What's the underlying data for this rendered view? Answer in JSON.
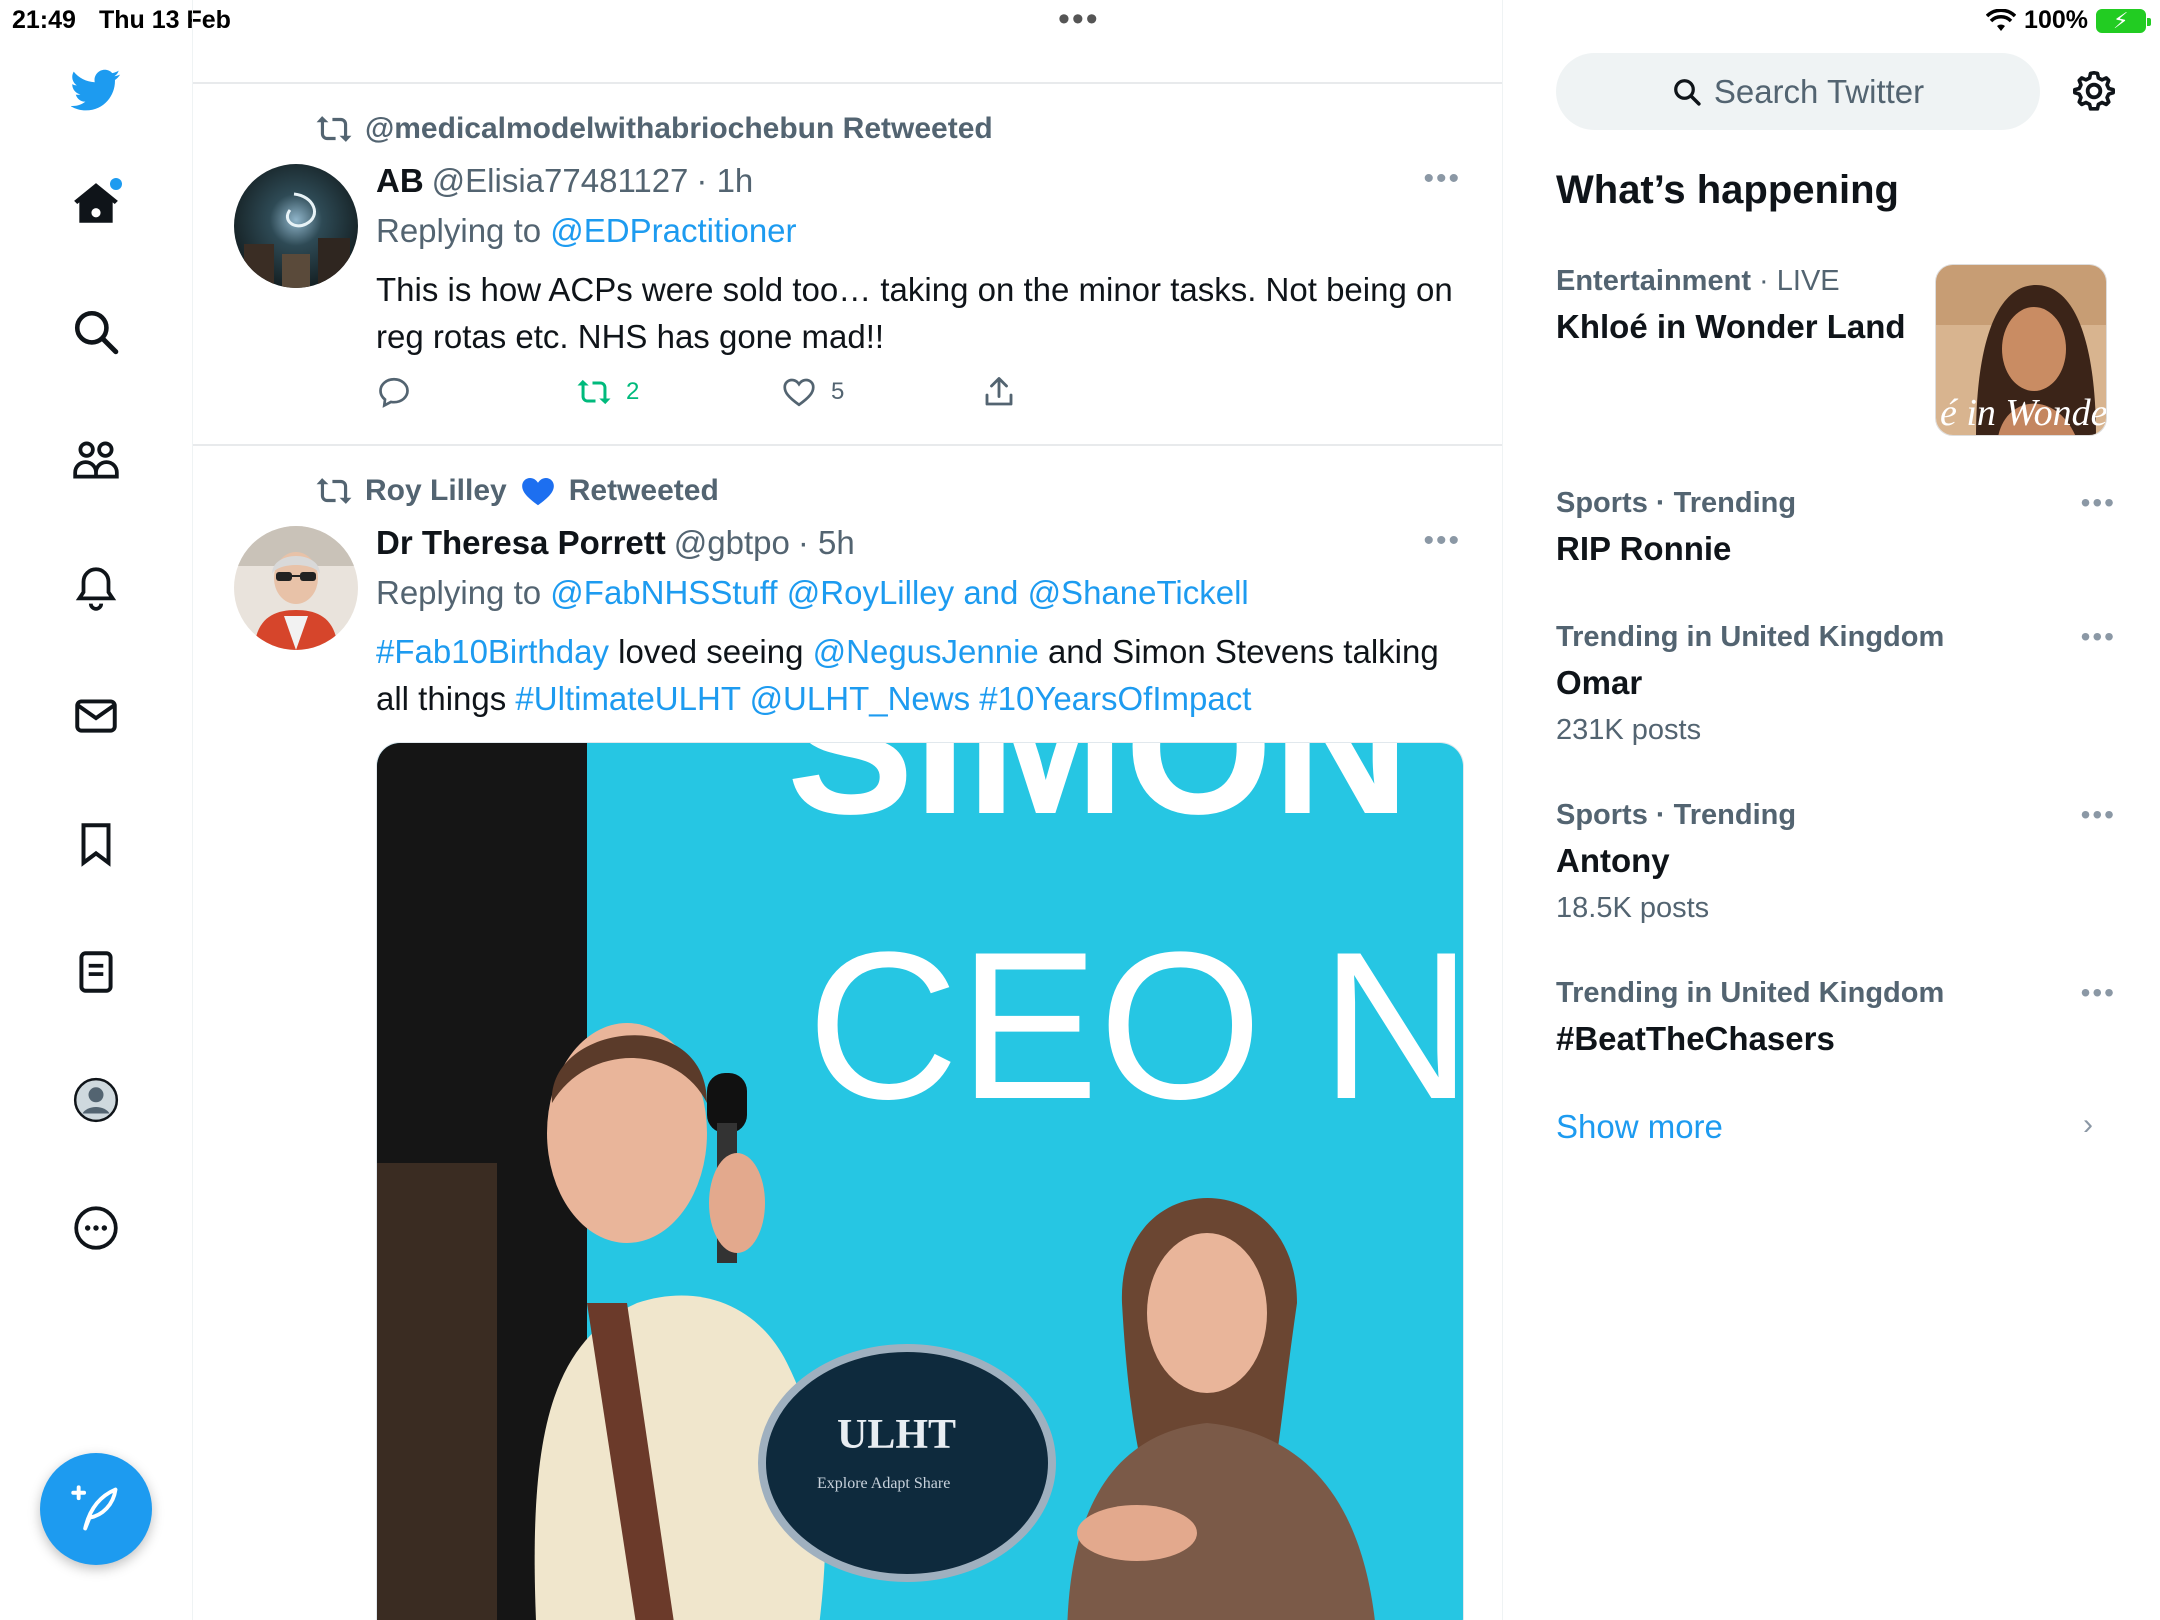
{
  "status_bar": {
    "time": "21:49",
    "date": "Thu 13 Feb",
    "battery": "100%"
  },
  "nav": {
    "items": [
      "home-icon",
      "search-icon",
      "communities-icon",
      "notifications-icon",
      "messages-icon",
      "bookmarks-icon",
      "lists-icon",
      "profile-icon",
      "more-icon"
    ],
    "compose": "compose-tweet-icon"
  },
  "tweets": [
    {
      "retweeted_by": "@medicalmodelwithabriochebun Retweeted",
      "name": "AB",
      "handle": "@Elisia77481127",
      "time": "· 1h",
      "replying_label": "Replying to",
      "replying_to": "@EDPractitioner",
      "text": "This is how ACPs were sold too… taking on the minor tasks. Not being on reg rotas etc. NHS has gone mad!!",
      "retweets": "2",
      "likes": "5"
    },
    {
      "retweeted_by_name": "Roy Lilley",
      "retweeted_by_suffix": "Retweeted",
      "name": "Dr Theresa Porrett",
      "handle": "@gbtpo",
      "time": "· 5h",
      "replying_label": "Replying to",
      "replying_to_1": "@FabNHSStuff",
      "replying_to_2": "@RoyLilley",
      "replying_and": "and",
      "replying_to_3": "@ShaneTickell",
      "text_hashtag1": "#Fab10Birthday",
      "text_part1": "loved seeing",
      "text_mention1": "@NegusJennie",
      "text_part2": "and Simon Stevens  talking all things",
      "text_hashtag2": "#UltimateULHT",
      "text_mention2": "@ULHT_News",
      "text_hashtag3": "#10YearsOfImpact",
      "media_text_top": "SIMON",
      "media_text_mid": "CEO NH",
      "plaque_title": "ULHT",
      "plaque_line": "Explore Adapt Share"
    }
  ],
  "sidebar": {
    "search_placeholder": "Search Twitter",
    "whats_happening": "What’s happening",
    "trends": [
      {
        "category": "Entertainment",
        "live": "· LIVE",
        "topic": "Khloé in Wonder Land",
        "image_caption": "é in Wonder l"
      },
      {
        "category": "Sports · Trending",
        "topic": "RIP Ronnie"
      },
      {
        "category": "Trending in United Kingdom",
        "topic": "Omar",
        "count": "231K posts"
      },
      {
        "category": "Sports · Trending",
        "topic": "Antony",
        "count": "18.5K posts"
      },
      {
        "category": "Trending in United Kingdom",
        "topic": "#BeatTheChasers"
      }
    ],
    "show_more": "Show more"
  },
  "colors": {
    "accent": "#1d9bf0",
    "retweet_green": "#00ba7c",
    "secondary_text": "#536471"
  }
}
